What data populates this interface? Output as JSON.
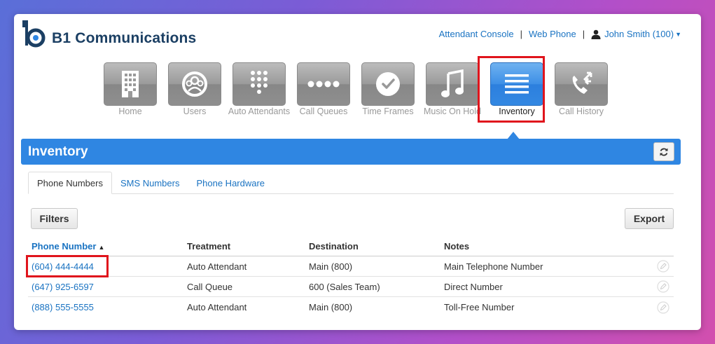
{
  "brand": {
    "name": "B1 Communications",
    "color": "#1b3f63"
  },
  "top_links": {
    "attendant_console": "Attendant Console",
    "separator": "|",
    "web_phone": "Web Phone",
    "user": "John Smith (100)"
  },
  "nav": [
    {
      "label": "Home",
      "icon": "building-icon"
    },
    {
      "label": "Users",
      "icon": "users-icon"
    },
    {
      "label": "Auto Attendants",
      "icon": "keypad-icon"
    },
    {
      "label": "Call Queues",
      "icon": "dots-icon"
    },
    {
      "label": "Time Frames",
      "icon": "clock-icon"
    },
    {
      "label": "Music On Hold",
      "icon": "music-note-icon"
    },
    {
      "label": "Inventory",
      "icon": "list-icon",
      "active": true
    },
    {
      "label": "Call History",
      "icon": "phone-arrows-icon"
    }
  ],
  "section": {
    "title": "Inventory",
    "accent": "#2f86e2"
  },
  "tabs": [
    {
      "label": "Phone Numbers",
      "active": true
    },
    {
      "label": "SMS Numbers"
    },
    {
      "label": "Phone Hardware"
    }
  ],
  "buttons": {
    "filters": "Filters",
    "export": "Export"
  },
  "table": {
    "columns": [
      "Phone Number",
      "Treatment",
      "Destination",
      "Notes"
    ],
    "rows": [
      [
        "(604) 444-4444",
        "Auto Attendant",
        "Main (800)",
        "Main Telephone Number"
      ],
      [
        "(647) 925-6597",
        "Call Queue",
        "600 (Sales Team)",
        "Direct Number"
      ],
      [
        "(888) 555-5555",
        "Auto Attendant",
        "Main (800)",
        "Toll-Free Number"
      ]
    ]
  },
  "highlight_color": "#e0141c"
}
